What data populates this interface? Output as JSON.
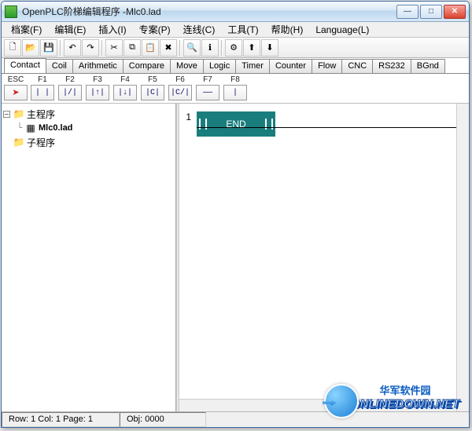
{
  "window": {
    "title": "OpenPLC阶梯编辑程序 -Mlc0.lad"
  },
  "menu": {
    "items": [
      "档案(F)",
      "编辑(E)",
      "插入(I)",
      "专案(P)",
      "连线(C)",
      "工具(T)",
      "帮助(H)",
      "Language(L)"
    ]
  },
  "toolbar": {
    "icons": [
      "new",
      "open",
      "save",
      "|",
      "undo",
      "redo",
      "|",
      "cut",
      "copy",
      "paste",
      "delete",
      "|",
      "find",
      "info",
      "|",
      "compile",
      "upload",
      "download"
    ]
  },
  "tabs": {
    "items": [
      "Contact",
      "Coil",
      "Arithmetic",
      "Compare",
      "Move",
      "Logic",
      "Timer",
      "Counter",
      "Flow",
      "CNC",
      "RS232",
      "BGnd"
    ],
    "active_index": 0
  },
  "fkeys": {
    "items": [
      {
        "label": "ESC",
        "glyph": "arrow"
      },
      {
        "label": "F1",
        "glyph": "| |"
      },
      {
        "label": "F2",
        "glyph": "|/|"
      },
      {
        "label": "F3",
        "glyph": "|↑|"
      },
      {
        "label": "F4",
        "glyph": "|↓|"
      },
      {
        "label": "F5",
        "glyph": "|C|"
      },
      {
        "label": "F6",
        "glyph": "|C/|"
      },
      {
        "label": "F7",
        "glyph": "——"
      },
      {
        "label": "F8",
        "glyph": "|"
      }
    ]
  },
  "tree": {
    "root1": {
      "label": "主程序",
      "expanded": true,
      "child": {
        "label": "Mlc0.lad"
      }
    },
    "root2": {
      "label": "子程序"
    }
  },
  "editor": {
    "rung_number": "1",
    "end_label": "END"
  },
  "status": {
    "pos": "Row: 1  Col: 1  Page: 1",
    "obj": "Obj: 0000"
  },
  "watermark": {
    "top": "华军软件园",
    "bottom": "ONLINEDOWN.NET"
  }
}
